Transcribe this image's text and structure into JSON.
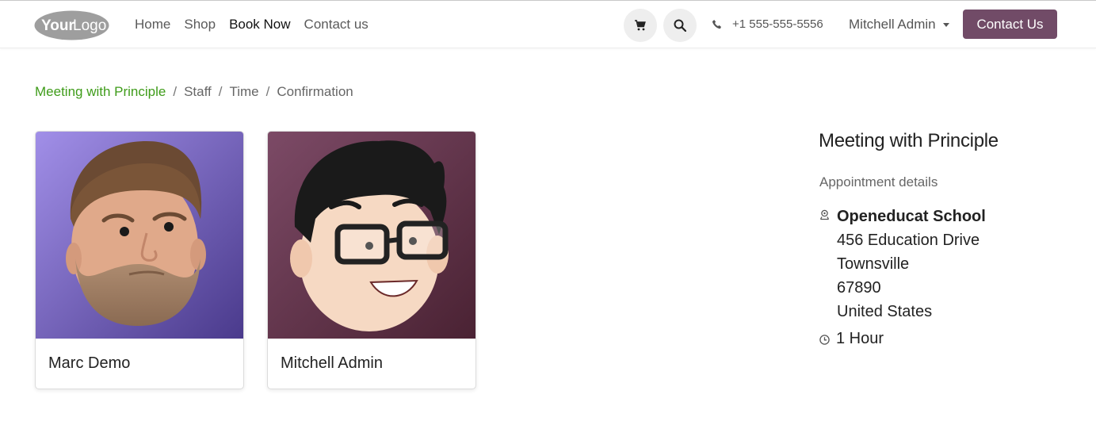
{
  "header": {
    "logo_text": "YourLogo",
    "nav": [
      "Home",
      "Shop",
      "Book Now",
      "Contact us"
    ],
    "active_nav": "Book Now",
    "phone": "+1 555-555-5556",
    "user": "Mitchell Admin",
    "cta_label": "Contact Us",
    "icons": [
      "cart-icon",
      "search-icon",
      "phone-icon",
      "chevron-down-icon"
    ]
  },
  "breadcrumb": {
    "items": [
      "Meeting with Principle",
      "Staff",
      "Time",
      "Confirmation"
    ]
  },
  "staff": [
    {
      "name": "Marc Demo"
    },
    {
      "name": "Mitchell Admin"
    }
  ],
  "sidebar": {
    "title": "Meeting with Principle",
    "subtitle": "Appointment details",
    "company": "Openeducat School",
    "address": [
      "456 Education Drive",
      "Townsville",
      "67890",
      "United States"
    ],
    "duration": "1 Hour"
  },
  "colors": {
    "brand": "#714b67",
    "link_green": "#3f9c1a",
    "card1_bg": "#6a4fb3",
    "card2_bg": "#6b3a55"
  }
}
